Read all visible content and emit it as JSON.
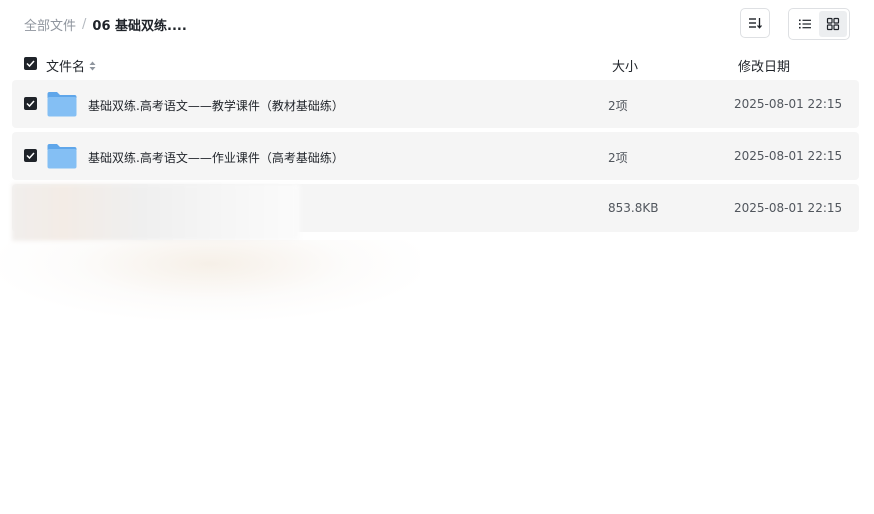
{
  "breadcrumb": {
    "root": "全部文件",
    "separator": "/",
    "current": "06 基础双练...."
  },
  "toolbar": {
    "sort_icon": "sort-lines-icon",
    "list_view_icon": "list-view-icon",
    "grid_view_icon": "grid-view-icon",
    "active_view": "list"
  },
  "table": {
    "columns": {
      "name": "文件名",
      "size": "大小",
      "date": "修改日期"
    },
    "rows": [
      {
        "type": "folder",
        "checked": true,
        "name": "基础双练.高考语文——教学课件（教材基础练）",
        "size": "2项",
        "date": "2025-08-01 22:15"
      },
      {
        "type": "folder",
        "checked": true,
        "name": "基础双练.高考语文——作业课件（高考基础练）",
        "size": "2项",
        "date": "2025-08-01 22:15"
      },
      {
        "type": "file",
        "checked": false,
        "name": "",
        "size": "853.8KB",
        "date": "2025-08-01 22:15"
      }
    ]
  },
  "colors": {
    "row_bg": "#f5f5f5",
    "checkbox": "#1f2329",
    "folder": "#7cb8f0",
    "text_secondary": "#8f959e"
  }
}
